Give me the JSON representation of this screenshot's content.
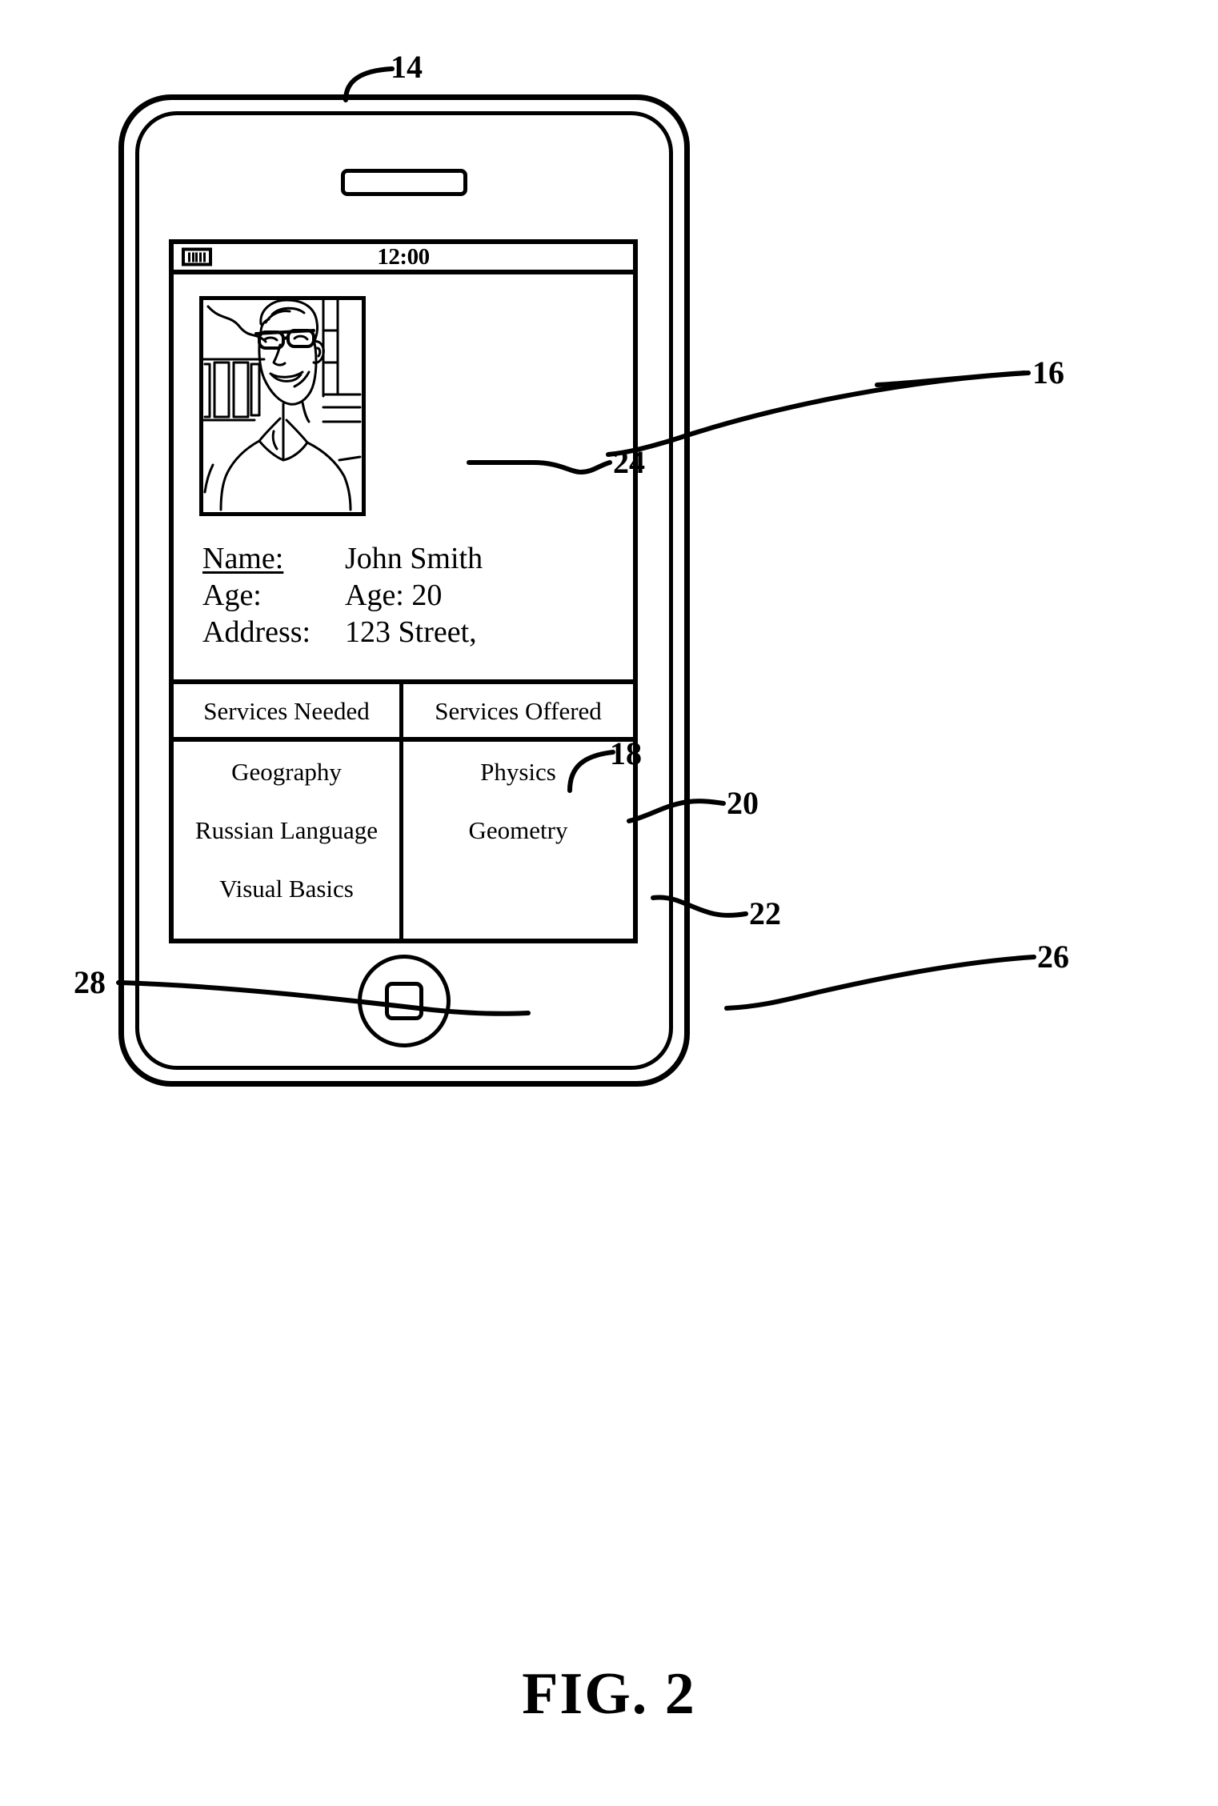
{
  "figure": {
    "caption": "FIG.  2",
    "reference_numerals": [
      {
        "id": "14",
        "label": "14",
        "target": "phone-device"
      },
      {
        "id": "16",
        "label": "16",
        "target": "screen"
      },
      {
        "id": "18",
        "label": "18",
        "target": "name-value"
      },
      {
        "id": "20",
        "label": "20",
        "target": "age-value"
      },
      {
        "id": "22",
        "label": "22",
        "target": "address-value"
      },
      {
        "id": "24",
        "label": "24",
        "target": "profile-photo"
      },
      {
        "id": "26",
        "label": "26",
        "target": "services-offered-header"
      },
      {
        "id": "28",
        "label": "28",
        "target": "services-needed-header"
      }
    ]
  },
  "device": {
    "name": "mobile-phone",
    "earpiece": "speaker-slot",
    "home_button": "home-button"
  },
  "screen": {
    "status_bar": {
      "battery_icon": "battery-icon",
      "battery_bars": 5,
      "time": "12:00"
    },
    "profile": {
      "photo_alt": "portrait-of-man-with-glasses",
      "fields": [
        {
          "label": "Name:",
          "value": "John Smith",
          "underlined": true
        },
        {
          "label": "Age:",
          "value": "Age: 20",
          "underlined": false
        },
        {
          "label": "Address:",
          "value": "123 Street,",
          "underlined": false
        }
      ]
    },
    "services": {
      "headers": [
        "Services Needed",
        "Services Offered"
      ],
      "needed": [
        "Geography",
        "Russian Language",
        "Visual Basics"
      ],
      "offered": [
        "Physics",
        "Geometry"
      ]
    }
  },
  "colors": {
    "ink": "#000000",
    "paper": "#ffffff"
  }
}
